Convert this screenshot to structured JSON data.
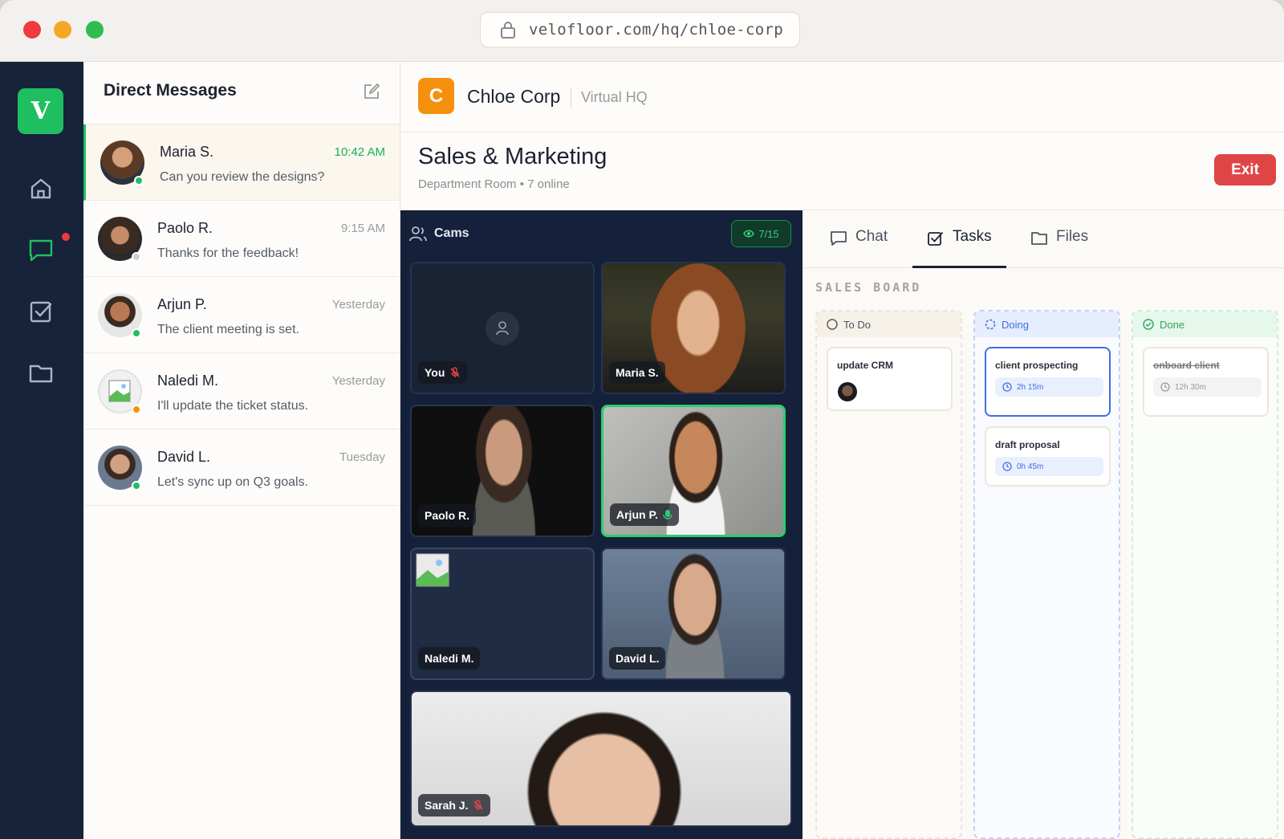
{
  "browser": {
    "url": "velofloor.com/hq/chloe-corp"
  },
  "rail": {
    "logo_letter": "V",
    "items": [
      {
        "icon": "home-icon"
      },
      {
        "icon": "chat-icon",
        "has_badge": true
      },
      {
        "icon": "tasks-icon"
      },
      {
        "icon": "folder-icon"
      }
    ],
    "accent": "#1fbf61",
    "badge_color": "#ee3b3b"
  },
  "dm": {
    "title": "Direct Messages",
    "items": [
      {
        "name": "Maria S.",
        "time": "10:42 AM",
        "message": "Can you review the designs?",
        "status": "online",
        "unread": true
      },
      {
        "name": "Paolo R.",
        "time": "9:15 AM",
        "message": "Thanks for the feedback!",
        "status": "offline"
      },
      {
        "name": "Arjun P.",
        "time": "Yesterday",
        "message": "The client meeting is set.",
        "status": "online"
      },
      {
        "name": "Naledi M.",
        "time": "Yesterday",
        "message": "I'll update the ticket status.",
        "status": "away"
      },
      {
        "name": "David L.",
        "time": "Tuesday",
        "message": "Let's sync up on Q3 goals.",
        "status": "online"
      }
    ]
  },
  "header": {
    "org_initial": "C",
    "org_name": "Chloe Corp",
    "org_sub": "Virtual HQ"
  },
  "room": {
    "title": "Sales & Marketing",
    "subtitle": "Department Room • 7 online",
    "exit_label": "Exit"
  },
  "cams": {
    "title": "Cams",
    "count": "7/15",
    "tiles": [
      {
        "label": "You",
        "muted": true
      },
      {
        "label": "Maria S."
      },
      {
        "label": "Paolo R."
      },
      {
        "label": "Arjun P.",
        "speaking": true
      },
      {
        "label": "Naledi M."
      },
      {
        "label": "David L."
      },
      {
        "label": "Sarah J.",
        "muted": true
      }
    ]
  },
  "panel": {
    "tabs": [
      {
        "label": "Chat",
        "icon": "chat-icon"
      },
      {
        "label": "Tasks",
        "icon": "tasks-icon",
        "active": true
      },
      {
        "label": "Files",
        "icon": "folder-icon"
      }
    ],
    "board_title": "SALES BOARD",
    "columns": [
      {
        "label": "To Do",
        "cards": [
          {
            "title": "update CRM"
          }
        ]
      },
      {
        "label": "Doing",
        "cards": [
          {
            "title": "client prospecting",
            "timer": "2h 15m"
          },
          {
            "title": "draft proposal",
            "timer": "0h 45m"
          }
        ]
      },
      {
        "label": "Done",
        "cards": [
          {
            "title": "onboard client",
            "timer": "12h 30m"
          }
        ]
      }
    ]
  }
}
